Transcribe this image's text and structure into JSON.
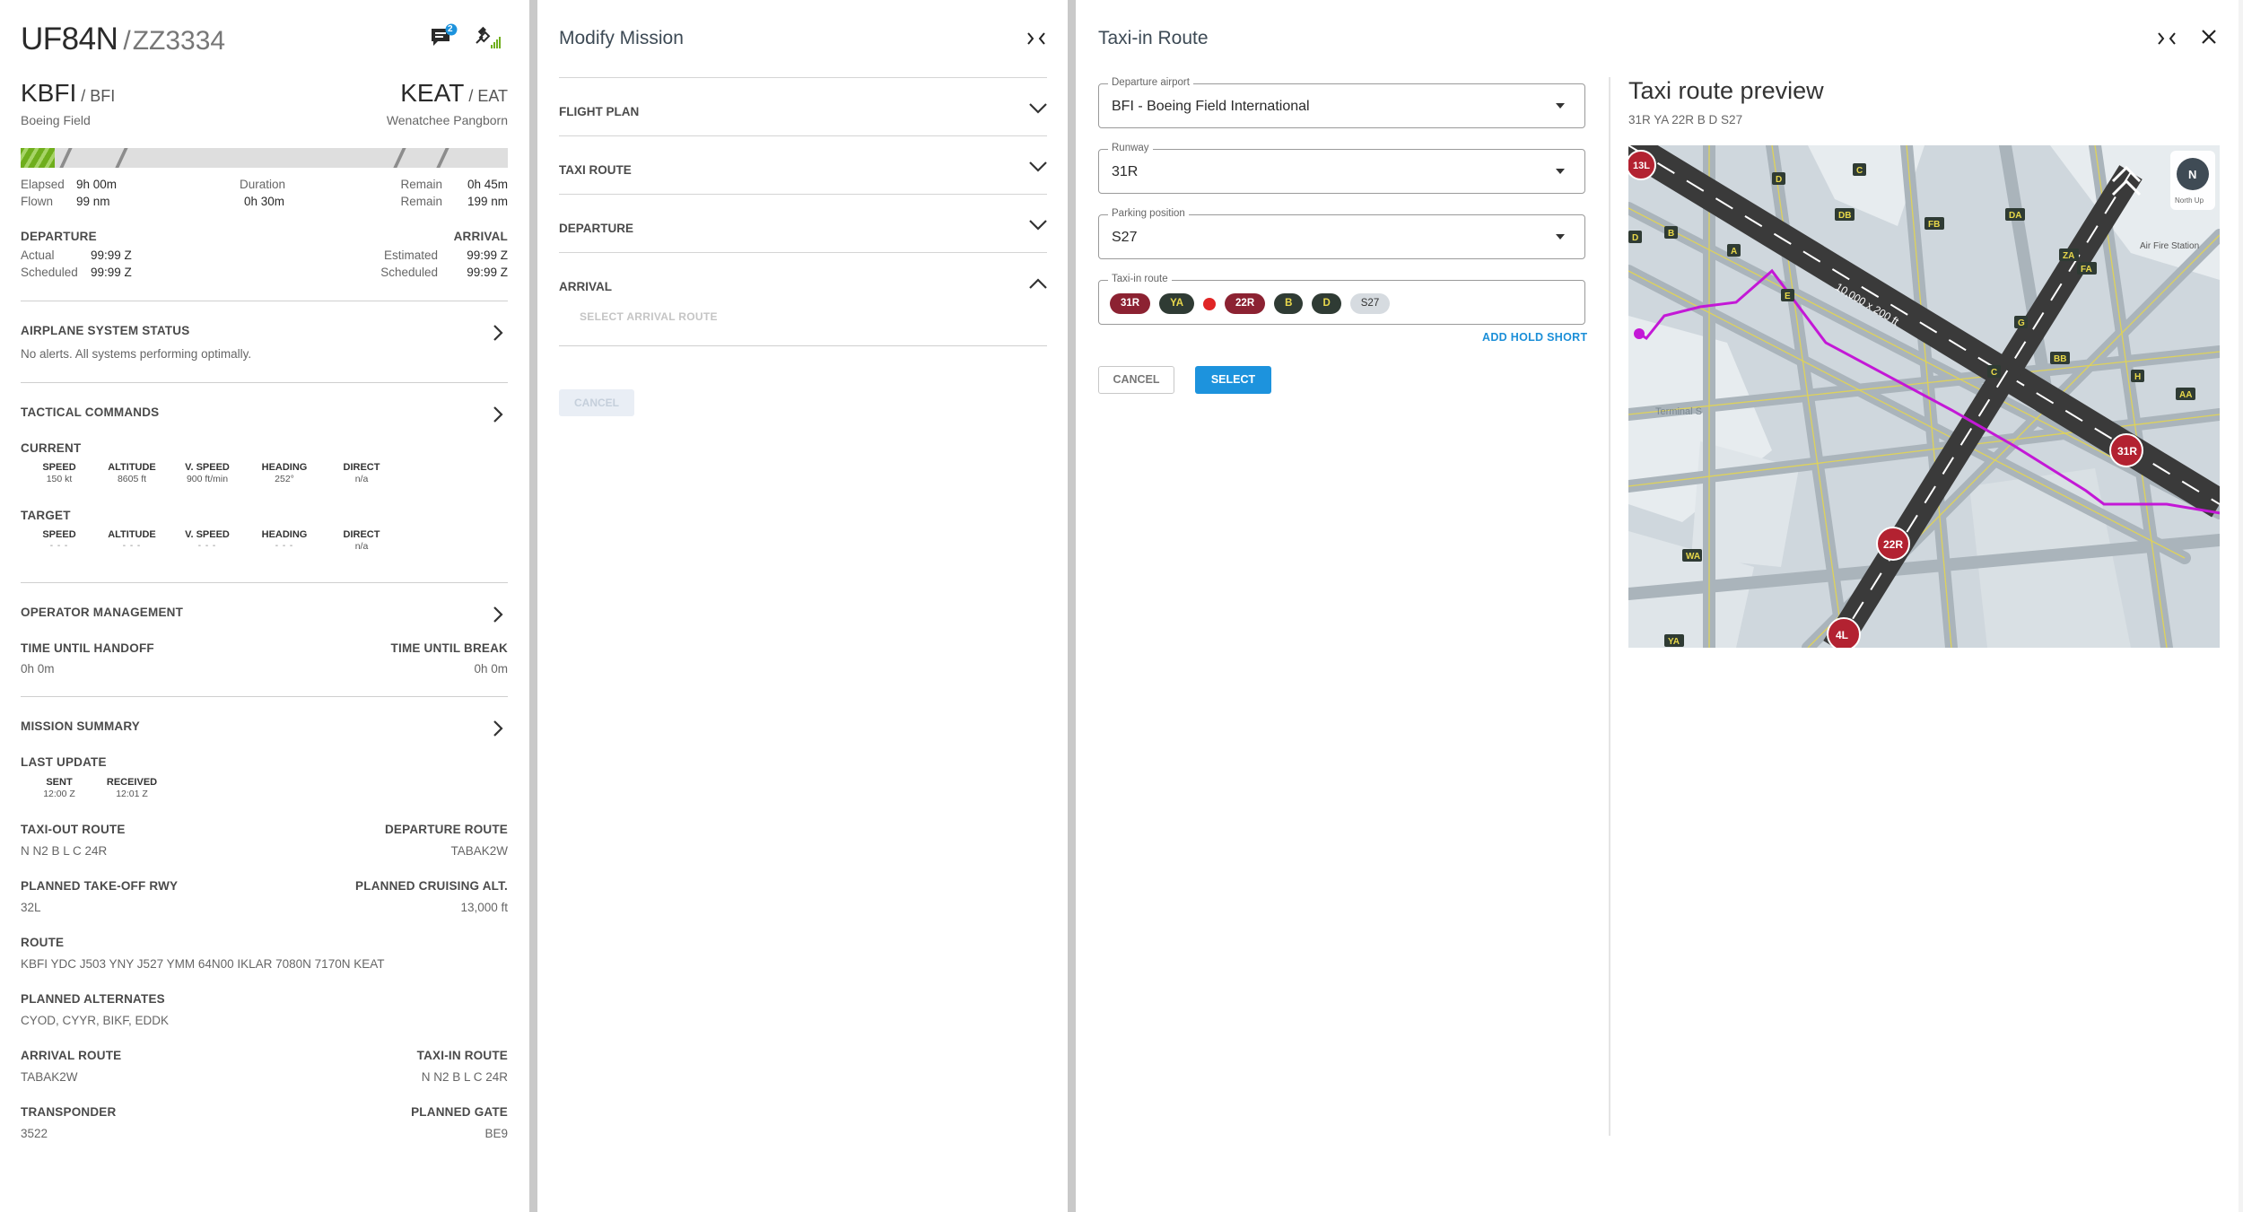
{
  "flight": {
    "callsign": "UF84N",
    "separator": "/",
    "alt_callsign": "ZZ3334",
    "message_badge": "2",
    "departure": {
      "icao": "KBFI",
      "sep": " / ",
      "iata": "BFI",
      "name": "Boeing Field"
    },
    "arrival": {
      "icao": "KEAT",
      "sep": " / ",
      "iata": "EAT",
      "name": "Wenatchee Pangborn"
    },
    "progress_fraction": 0.07,
    "times": {
      "elapsed_label": "Elapsed",
      "elapsed": "9h 00m",
      "flown_label": "Flown",
      "flown": "99 nm",
      "duration_label": "Duration",
      "duration": "0h 30m",
      "remain_label": "Remain",
      "remain_time": "0h 45m",
      "remain_dist": "199 nm"
    },
    "departure_block": {
      "title": "DEPARTURE",
      "actual_label": "Actual",
      "actual": "99:99 Z",
      "scheduled_label": "Scheduled",
      "scheduled": "99:99 Z"
    },
    "arrival_block": {
      "title": "ARRIVAL",
      "estimated_label": "Estimated",
      "estimated": "99:99 Z",
      "scheduled_label": "Scheduled",
      "scheduled": "99:99 Z"
    }
  },
  "system_status": {
    "title": "AIRPLANE SYSTEM STATUS",
    "text": "No alerts. All systems performing optimally."
  },
  "tactical": {
    "title": "TACTICAL COMMANDS",
    "current_label": "CURRENT",
    "target_label": "TARGET",
    "columns": [
      "SPEED",
      "ALTITUDE",
      "V. SPEED",
      "HEADING",
      "DIRECT"
    ],
    "current": [
      "150 kt",
      "8605 ft",
      "900 ft/min",
      "252°",
      "n/a"
    ],
    "target": [
      "- - -",
      "- - -",
      "- - -",
      "- - -",
      "n/a"
    ]
  },
  "operator": {
    "title": "OPERATOR MANAGEMENT",
    "handoff_label": "TIME UNTIL HANDOFF",
    "handoff": "0h 0m",
    "break_label": "TIME UNTIL BREAK",
    "break": "0h 0m"
  },
  "mission_summary": {
    "title": "MISSION SUMMARY",
    "last_update_label": "LAST UPDATE",
    "sent_label": "SENT",
    "sent": "12:00 Z",
    "received_label": "RECEIVED",
    "received": "12:01 Z",
    "taxi_out_label": "TAXI-OUT ROUTE",
    "taxi_out": "N N2 B L C 24R",
    "departure_route_label": "DEPARTURE ROUTE",
    "departure_route": "TABAK2W",
    "takeoff_rwy_label": "PLANNED TAKE-OFF RWY",
    "takeoff_rwy": "32L",
    "cruise_label": "PLANNED CRUISING ALT.",
    "cruise": "13,000 ft",
    "route_label": "ROUTE",
    "route": "KBFI YDC J503 YNY J527 YMM 64N00 IKLAR 7080N 7170N KEAT",
    "alternates_label": "PLANNED ALTERNATES",
    "alternates": "CYOD, CYYR, BIKF, EDDK",
    "arrival_route_label": "ARRIVAL ROUTE",
    "arrival_route": "TABAK2W",
    "taxi_in_label": "TAXI-IN ROUTE",
    "taxi_in": "N N2 B L C 24R",
    "transponder_label": "TRANSPONDER",
    "transponder": "3522",
    "gate_label": "PLANNED GATE",
    "gate": "BE9"
  },
  "modify": {
    "title": "Modify Mission",
    "sections": [
      "FLIGHT PLAN",
      "TAXI ROUTE",
      "DEPARTURE",
      "ARRIVAL"
    ],
    "arrival_placeholder": "SELECT ARRIVAL ROUTE",
    "cancel_label": "CANCEL"
  },
  "taxi": {
    "title": "Taxi-in Route",
    "departure_airport_label": "Departure airport",
    "departure_airport": "BFI - Boeing Field International",
    "runway_label": "Runway",
    "runway": "31R",
    "parking_label": "Parking position",
    "parking": "S27",
    "route_label": "Taxi-in route",
    "route_chips": [
      "31R",
      "YA",
      "22R",
      "B",
      "D",
      "S27"
    ],
    "add_hold_short": "ADD HOLD SHORT",
    "cancel_label": "CANCEL",
    "select_label": "SELECT",
    "preview_title": "Taxi route preview",
    "preview_route": "31R YA 22R B D S27"
  },
  "map": {
    "runway_length": "10,000 x 200 ft",
    "terminal_label": "Terminal S",
    "station_label": "Air Fire Station",
    "compass_label": "N",
    "north_up_label": "North Up",
    "runway_markers": [
      "13L",
      "31R",
      "22R",
      "4L"
    ],
    "taxiway_labels": [
      "D",
      "C",
      "B",
      "A",
      "E",
      "DB",
      "FB",
      "DA",
      "ZA",
      "FA",
      "G",
      "H",
      "AA",
      "BB",
      "WA",
      "YA"
    ],
    "colors": {
      "route": "#c318d6",
      "runway": "#3a3a3a",
      "marker": "#b32231",
      "taxiway_label": "#e8d84a",
      "ground": "#cfd7dd"
    }
  }
}
